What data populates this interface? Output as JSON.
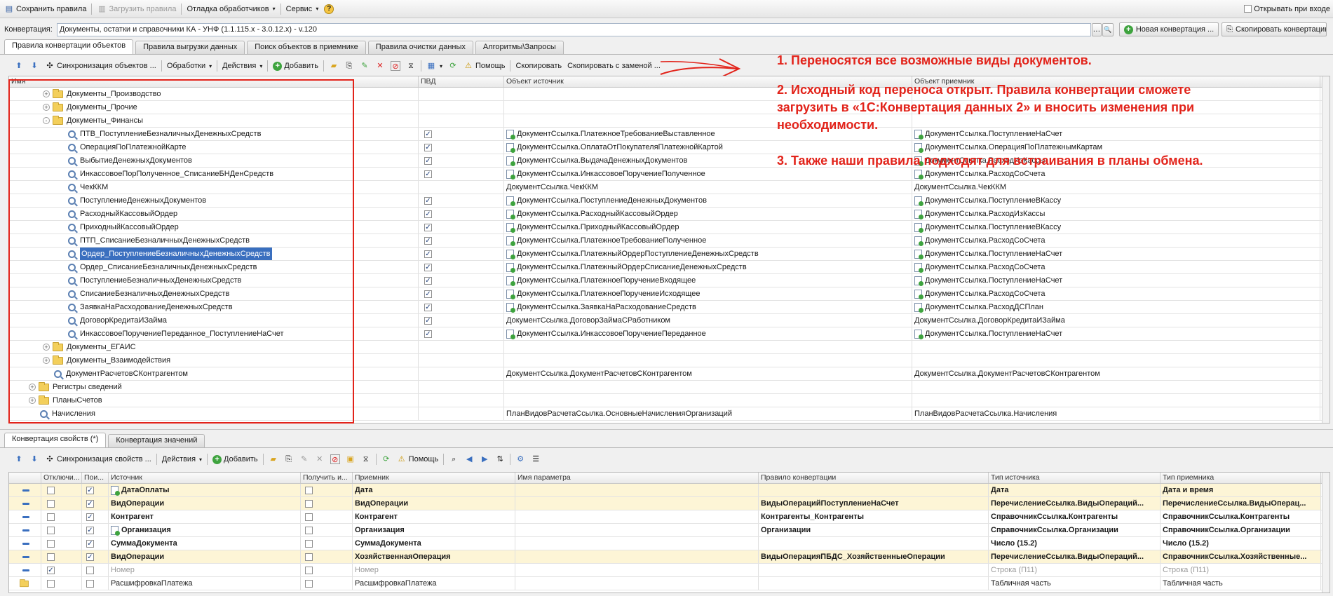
{
  "topbar": {
    "save": "Сохранить правила",
    "load": "Загрузить правила",
    "debug": "Отладка обработчиков",
    "service": "Сервис",
    "help": "?",
    "open_on_entry": "Открывать при входе"
  },
  "conversion": {
    "label": "Конвертация:",
    "value": "Документы, остатки и справочники КА - УНФ (1.1.115.x - 3.0.12.x) - v.120",
    "new_btn": "Новая конвертация ...",
    "copy_btn": "Скопировать конвертацию"
  },
  "tabs": [
    "Правила конвертации объектов",
    "Правила выгрузки данных",
    "Поиск объектов в приемнике",
    "Правила очистки данных",
    "Алгоритмы\\Запросы"
  ],
  "toolbar": {
    "sync": "Синхронизация объектов ...",
    "handlers": "Обработки",
    "actions": "Действия",
    "add": "Добавить",
    "help": "Помощь",
    "copy": "Скопировать",
    "copy_replace": "Скопировать с заменой ..."
  },
  "grid": {
    "headers": [
      "Имя",
      "ПВД",
      "Объект источник",
      "Объект приемник"
    ],
    "rows": [
      {
        "level": 2,
        "kind": "folder",
        "expander": "+",
        "name": "Документы_Производство",
        "pvd": false,
        "src": "",
        "src_icon": false,
        "dst": "",
        "dst_icon": false
      },
      {
        "level": 2,
        "kind": "folder",
        "expander": "+",
        "name": "Документы_Прочие",
        "pvd": false,
        "src": "",
        "src_icon": false,
        "dst": "",
        "dst_icon": false
      },
      {
        "level": 2,
        "kind": "folder",
        "expander": "-",
        "name": "Документы_Финансы",
        "pvd": false,
        "src": "",
        "src_icon": false,
        "dst": "",
        "dst_icon": false
      },
      {
        "level": 3,
        "kind": "rule",
        "name": "ПТВ_ПоступлениеБезналичныхДенежныхСредств",
        "pvd": true,
        "src": "ДокументСсылка.ПлатежноеТребованиеВыставленное",
        "src_icon": true,
        "dst": "ДокументСсылка.ПоступлениеНаСчет",
        "dst_icon": true
      },
      {
        "level": 3,
        "kind": "rule",
        "name": "ОперацияПоПлатежнойКарте",
        "pvd": true,
        "src": "ДокументСсылка.ОплатаОтПокупателяПлатежнойКартой",
        "src_icon": true,
        "dst": "ДокументСсылка.ОперацияПоПлатежнымКартам",
        "dst_icon": true
      },
      {
        "level": 3,
        "kind": "rule",
        "name": "ВыбытиеДенежныхДокументов",
        "pvd": true,
        "src": "ДокументСсылка.ВыдачаДенежныхДокументов",
        "src_icon": true,
        "dst": "ДокументСсылка.РасходИзКассы",
        "dst_icon": true
      },
      {
        "level": 3,
        "kind": "rule",
        "name": "ИнкассовоеПорПолученное_СписаниеБНДенСредств",
        "pvd": true,
        "src": "ДокументСсылка.ИнкассовоеПоручениеПолученное",
        "src_icon": true,
        "dst": "ДокументСсылка.РасходСоСчета",
        "dst_icon": true
      },
      {
        "level": 3,
        "kind": "rule",
        "name": "ЧекККМ",
        "pvd": false,
        "src": "ДокументСсылка.ЧекККМ",
        "src_icon": false,
        "dst": "ДокументСсылка.ЧекККМ",
        "dst_icon": false
      },
      {
        "level": 3,
        "kind": "rule",
        "name": "ПоступлениеДенежныхДокументов",
        "pvd": true,
        "src": "ДокументСсылка.ПоступлениеДенежныхДокументов",
        "src_icon": true,
        "dst": "ДокументСсылка.ПоступлениеВКассу",
        "dst_icon": true
      },
      {
        "level": 3,
        "kind": "rule",
        "name": "РасходныйКассовыйОрдер",
        "pvd": true,
        "src": "ДокументСсылка.РасходныйКассовыйОрдер",
        "src_icon": true,
        "dst": "ДокументСсылка.РасходИзКассы",
        "dst_icon": true
      },
      {
        "level": 3,
        "kind": "rule",
        "name": "ПриходныйКассовыйОрдер",
        "pvd": true,
        "src": "ДокументСсылка.ПриходныйКассовыйОрдер",
        "src_icon": true,
        "dst": "ДокументСсылка.ПоступлениеВКассу",
        "dst_icon": true
      },
      {
        "level": 3,
        "kind": "rule",
        "name": "ПТП_СписаниеБезналичныхДенежныхСредств",
        "pvd": true,
        "src": "ДокументСсылка.ПлатежноеТребованиеПолученное",
        "src_icon": true,
        "dst": "ДокументСсылка.РасходСоСчета",
        "dst_icon": true
      },
      {
        "level": 3,
        "kind": "rule",
        "name": "Ордер_ПоступлениеБезналичныхДенежныхСредств",
        "selected": true,
        "pvd": true,
        "src": "ДокументСсылка.ПлатежныйОрдерПоступлениеДенежныхСредств",
        "src_icon": true,
        "dst": "ДокументСсылка.ПоступлениеНаСчет",
        "dst_icon": true
      },
      {
        "level": 3,
        "kind": "rule",
        "name": "Ордер_СписаниеБезналичныхДенежныхСредств",
        "pvd": true,
        "src": "ДокументСсылка.ПлатежныйОрдерСписаниеДенежныхСредств",
        "src_icon": true,
        "dst": "ДокументСсылка.РасходСоСчета",
        "dst_icon": true
      },
      {
        "level": 3,
        "kind": "rule",
        "name": "ПоступлениеБезналичныхДенежныхСредств",
        "pvd": true,
        "src": "ДокументСсылка.ПлатежноеПоручениеВходящее",
        "src_icon": true,
        "dst": "ДокументСсылка.ПоступлениеНаСчет",
        "dst_icon": true
      },
      {
        "level": 3,
        "kind": "rule",
        "name": "СписаниеБезналичныхДенежныхСредств",
        "pvd": true,
        "src": "ДокументСсылка.ПлатежноеПоручениеИсходящее",
        "src_icon": true,
        "dst": "ДокументСсылка.РасходСоСчета",
        "dst_icon": true
      },
      {
        "level": 3,
        "kind": "rule",
        "name": "ЗаявкаНаРасходованиеДенежныхСредств",
        "pvd": true,
        "src": "ДокументСсылка.ЗаявкаНаРасходованиеСредств",
        "src_icon": true,
        "dst": "ДокументСсылка.РасходДСПлан",
        "dst_icon": true
      },
      {
        "level": 3,
        "kind": "rule",
        "name": "ДоговорКредитаИЗайма",
        "pvd": true,
        "src": "ДокументСсылка.ДоговорЗаймаСРаботником",
        "src_icon": false,
        "dst": "ДокументСсылка.ДоговорКредитаИЗайма",
        "dst_icon": false
      },
      {
        "level": 3,
        "kind": "rule",
        "name": "ИнкассовоеПоручениеПереданное_ПоступлениеНаСчет",
        "pvd": true,
        "src": "ДокументСсылка.ИнкассовоеПоручениеПереданное",
        "src_icon": true,
        "dst": "ДокументСсылка.ПоступлениеНаСчет",
        "dst_icon": true
      },
      {
        "level": 2,
        "kind": "folder",
        "expander": "+",
        "name": "Документы_ЕГАИС",
        "pvd": false,
        "src": "",
        "src_icon": false,
        "dst": "",
        "dst_icon": false
      },
      {
        "level": 2,
        "kind": "folder",
        "expander": "+",
        "name": "Документы_Взаимодействия",
        "pvd": false,
        "src": "",
        "src_icon": false,
        "dst": "",
        "dst_icon": false
      },
      {
        "level": 2,
        "kind": "rule",
        "name": "ДокументРасчетовСКонтрагентом",
        "pvd": false,
        "src": "ДокументСсылка.ДокументРасчетовСКонтрагентом",
        "src_icon": false,
        "dst": "ДокументСсылка.ДокументРасчетовСКонтрагентом",
        "dst_icon": false
      },
      {
        "level": 1,
        "kind": "folder",
        "expander": "+",
        "name": "Регистры сведений",
        "pvd": false,
        "src": "",
        "src_icon": false,
        "dst": "",
        "dst_icon": false
      },
      {
        "level": 1,
        "kind": "folder",
        "expander": "+",
        "name": "ПланыСчетов",
        "pvd": false,
        "src": "",
        "src_icon": false,
        "dst": "",
        "dst_icon": false
      },
      {
        "level": 1,
        "kind": "rule",
        "name": "Начисления",
        "pvd": false,
        "src": "ПланВидовРасчетаСсылка.ОсновныеНачисленияОрганизаций",
        "src_icon": false,
        "dst": "ПланВидовРасчетаСсылка.Начисления",
        "dst_icon": false
      }
    ]
  },
  "annotations": [
    "1. Переносятся все возможные виды документов.",
    "2. Исходный код переноса открыт. Правила конвертации сможете загрузить в «1С:Конвертация данных 2» и вносить изменения при необходимости.",
    "3. Также наши правила подходят для встраивания в планы обмена."
  ],
  "bottom_tabs": [
    "Конвертация свойств (*)",
    "Конвертация значений"
  ],
  "bottom_toolbar": {
    "sync": "Синхронизация свойств ...",
    "actions": "Действия",
    "add": "Добавить",
    "help": "Помощь"
  },
  "props": {
    "headers": [
      "",
      "Отключи...",
      "Пои...",
      "Источник",
      "Получить и...",
      "Приемник",
      "Имя параметра",
      "Правило конвертации",
      "Тип источника",
      "Тип приемника"
    ],
    "rows": [
      {
        "off": false,
        "search": true,
        "src": "ДатаОплаты",
        "src_icon": true,
        "get": false,
        "dst": "Дата",
        "param": "",
        "rule": "",
        "src_type": "Дата",
        "dst_type": "Дата и время",
        "style": "highlight"
      },
      {
        "off": false,
        "search": true,
        "src": "ВидОперации",
        "src_icon": false,
        "get": false,
        "dst": "ВидОперации",
        "param": "",
        "rule": "ВидыОперацийПоступлениеНаСчет",
        "src_type": "ПеречислениеСсылка.ВидыОпераций...",
        "dst_type": "ПеречислениеСсылка.ВидыОперац...",
        "style": "highlight"
      },
      {
        "off": false,
        "search": true,
        "src": "Контрагент",
        "src_icon": false,
        "get": false,
        "dst": "Контрагент",
        "param": "",
        "rule": "Контрагенты_Контрагенты",
        "src_type": "СправочникСсылка.Контрагенты",
        "dst_type": "СправочникСсылка.Контрагенты",
        "style": "bold"
      },
      {
        "off": false,
        "search": true,
        "src": "Организация",
        "src_icon": true,
        "get": false,
        "dst": "Организация",
        "param": "",
        "rule": "Организации",
        "src_type": "СправочникСсылка.Организации",
        "dst_type": "СправочникСсылка.Организации",
        "style": "bold"
      },
      {
        "off": false,
        "search": true,
        "src": "СуммаДокумента",
        "src_icon": false,
        "get": false,
        "dst": "СуммаДокумента",
        "param": "",
        "rule": "",
        "src_type": "Число (15.2)",
        "dst_type": "Число (15.2)",
        "style": "bold"
      },
      {
        "off": false,
        "search": true,
        "src": "ВидОперации",
        "src_icon": false,
        "get": false,
        "dst": "ХозяйственнаяОперация",
        "param": "",
        "rule": "ВидыОперацияПБДС_ХозяйственныеОперации",
        "src_type": "ПеречислениеСсылка.ВидыОпераций...",
        "dst_type": "СправочникСсылка.Хозяйственные...",
        "style": "highlight"
      },
      {
        "off": true,
        "search": false,
        "src": "Номер",
        "src_icon": false,
        "get": false,
        "dst": "Номер",
        "param": "",
        "rule": "",
        "src_type": "Строка (П11)",
        "dst_type": "Строка (П11)",
        "style": "grey"
      },
      {
        "off": false,
        "search": false,
        "src": "РасшифровкаПлатежа",
        "src_icon": false,
        "get": false,
        "dst": "РасшифровкаПлатежа",
        "param": "",
        "rule": "",
        "src_type": "Табличная часть",
        "dst_type": "Табличная часть",
        "style": "folder"
      }
    ]
  },
  "colors": {
    "annotation": "#e2231a",
    "selection": "#3a6fbf",
    "highlight_row": "#fdf5d6"
  }
}
